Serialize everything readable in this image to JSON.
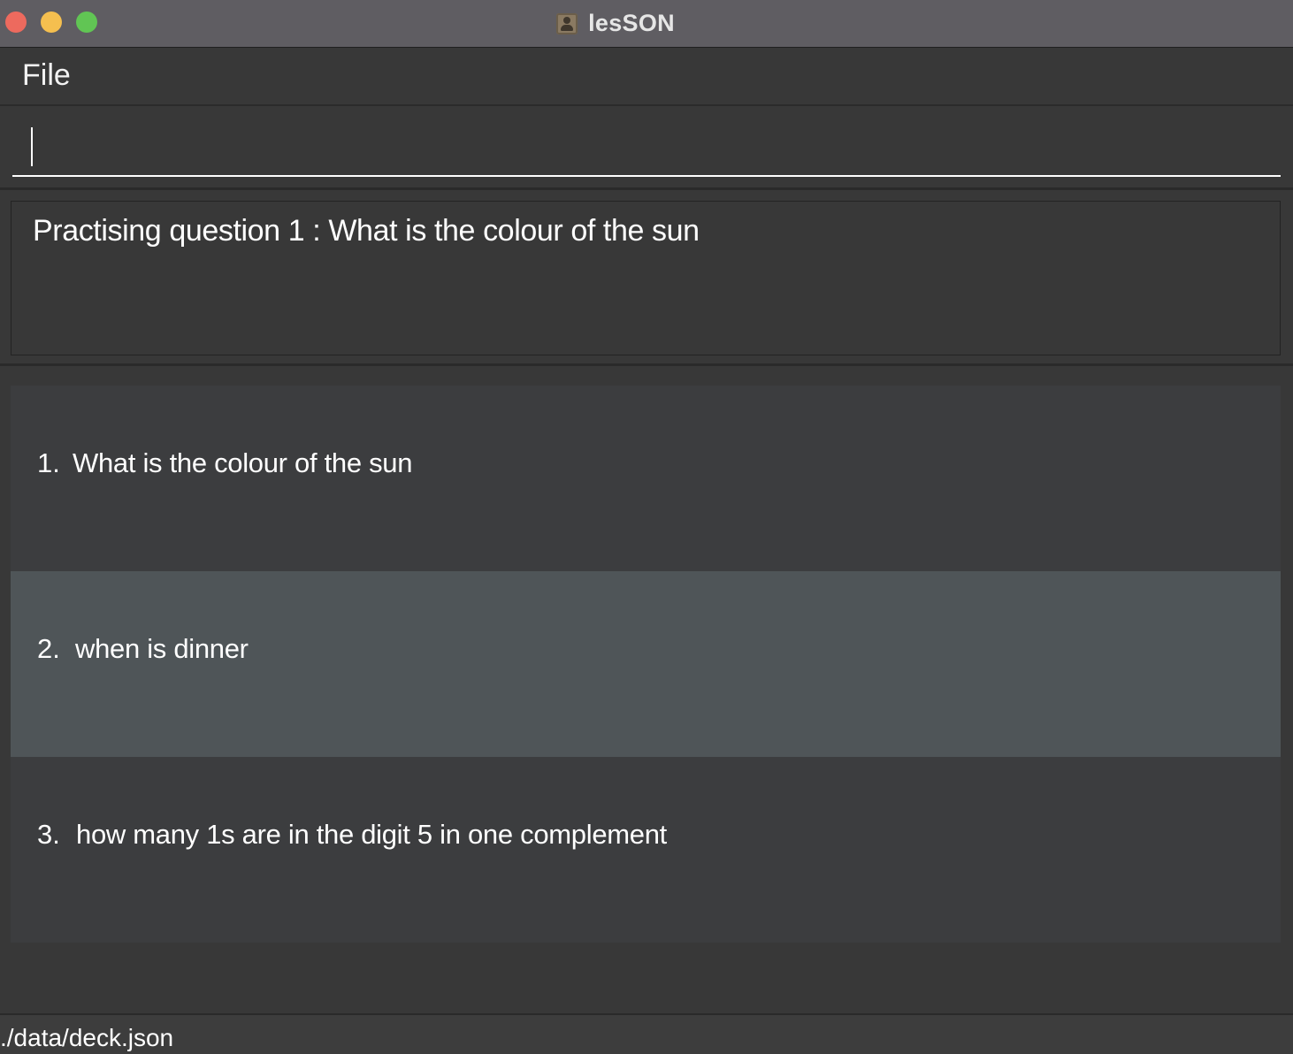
{
  "window": {
    "title": "lesSON",
    "controls": {
      "close_color": "#ed6a5e",
      "minimize_color": "#f5bf4f",
      "maximize_color": "#61c554"
    },
    "app_icon": "contact-card-icon"
  },
  "menu": {
    "file_label": "File"
  },
  "command": {
    "value": "",
    "placeholder": ""
  },
  "result": {
    "text": "Practising question 1 : What is the colour of the sun"
  },
  "questions": [
    {
      "index": "1.",
      "text": "What is the colour of the sun",
      "selected": false
    },
    {
      "index": "2.",
      "text": "when is dinner",
      "selected": true
    },
    {
      "index": "3.",
      "text": "how many 1s are in the digit 5 in one complement",
      "selected": false
    }
  ],
  "status": {
    "path": "./data/deck.json"
  },
  "colors": {
    "background": "#383838",
    "list_item": "#3c3d3f",
    "list_item_selected": "#4f5558",
    "titlebar": "#5f5d62"
  }
}
